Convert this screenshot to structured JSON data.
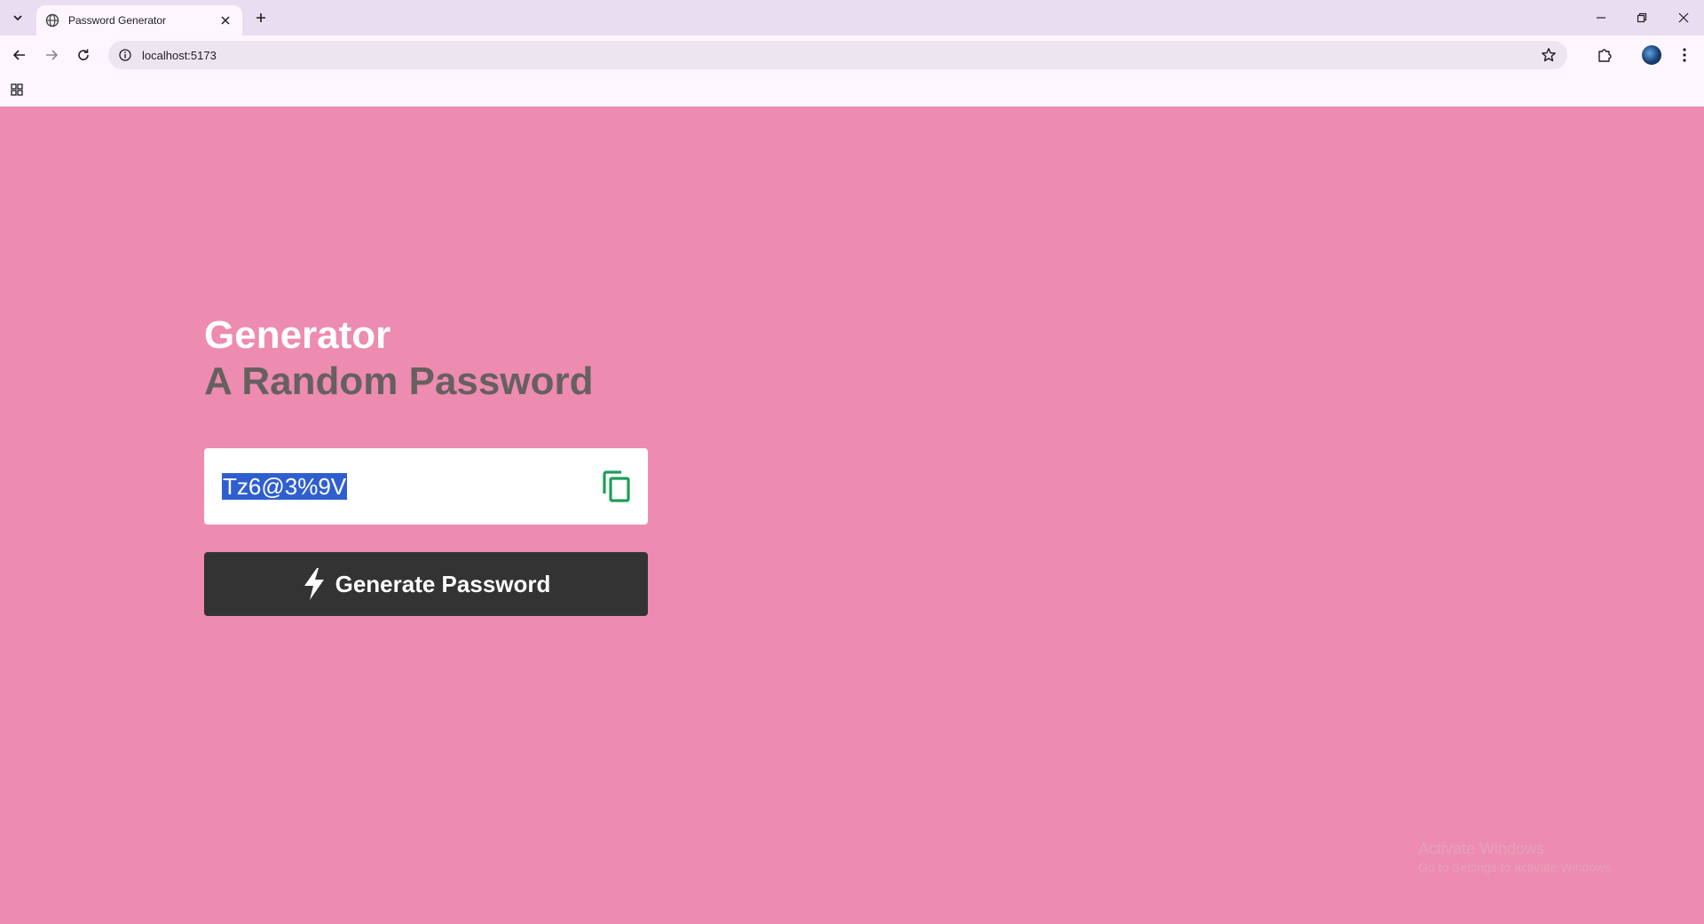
{
  "browser": {
    "tab_title": "Password Generator",
    "url": "localhost:5173"
  },
  "page": {
    "heading_line1": "Generator",
    "heading_line2": "A Random Password",
    "password_value": "Tz6@3%9V",
    "generate_label": "Generate Password"
  },
  "watermark": {
    "line1": "Activate Windows",
    "line2": "Go to Settings to activate Windows."
  },
  "colors": {
    "page_background": "#ed8bb0",
    "button_background": "#333333",
    "copy_icon": "#1e9e5a",
    "selection": "#2f5fcf",
    "subheading": "#666060"
  },
  "icons": {
    "copy": "copy-icon",
    "generate": "bolt-icon"
  }
}
